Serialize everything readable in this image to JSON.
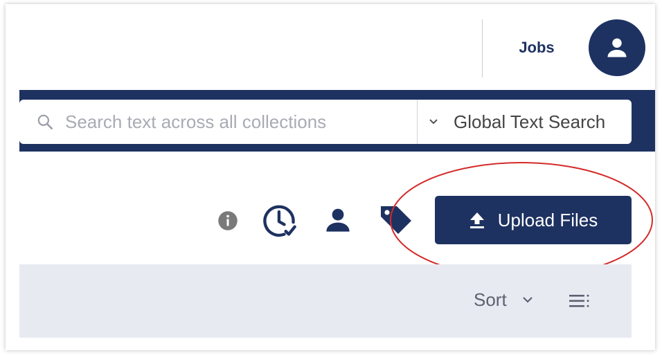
{
  "header": {
    "jobs_label": "Jobs",
    "avatar_icon": "user-icon"
  },
  "search": {
    "placeholder": "Search text across all collections",
    "value": "",
    "mode_label": "Global Text Search",
    "search_icon": "search-icon",
    "mode_dropdown_icon": "chevron-down-icon"
  },
  "toolbar": {
    "icons": [
      "info-icon",
      "history-icon",
      "user-icon",
      "tag-icon"
    ],
    "upload_label": "Upload Files",
    "upload_icon": "upload-icon"
  },
  "list": {
    "sort_label": "Sort",
    "sort_icon": "chevron-down-icon",
    "view_icon": "list-view-icon"
  },
  "colors": {
    "navy": "#1e3261",
    "annotation_red": "#d42a2a",
    "list_header_bg": "#e8eaf2"
  }
}
